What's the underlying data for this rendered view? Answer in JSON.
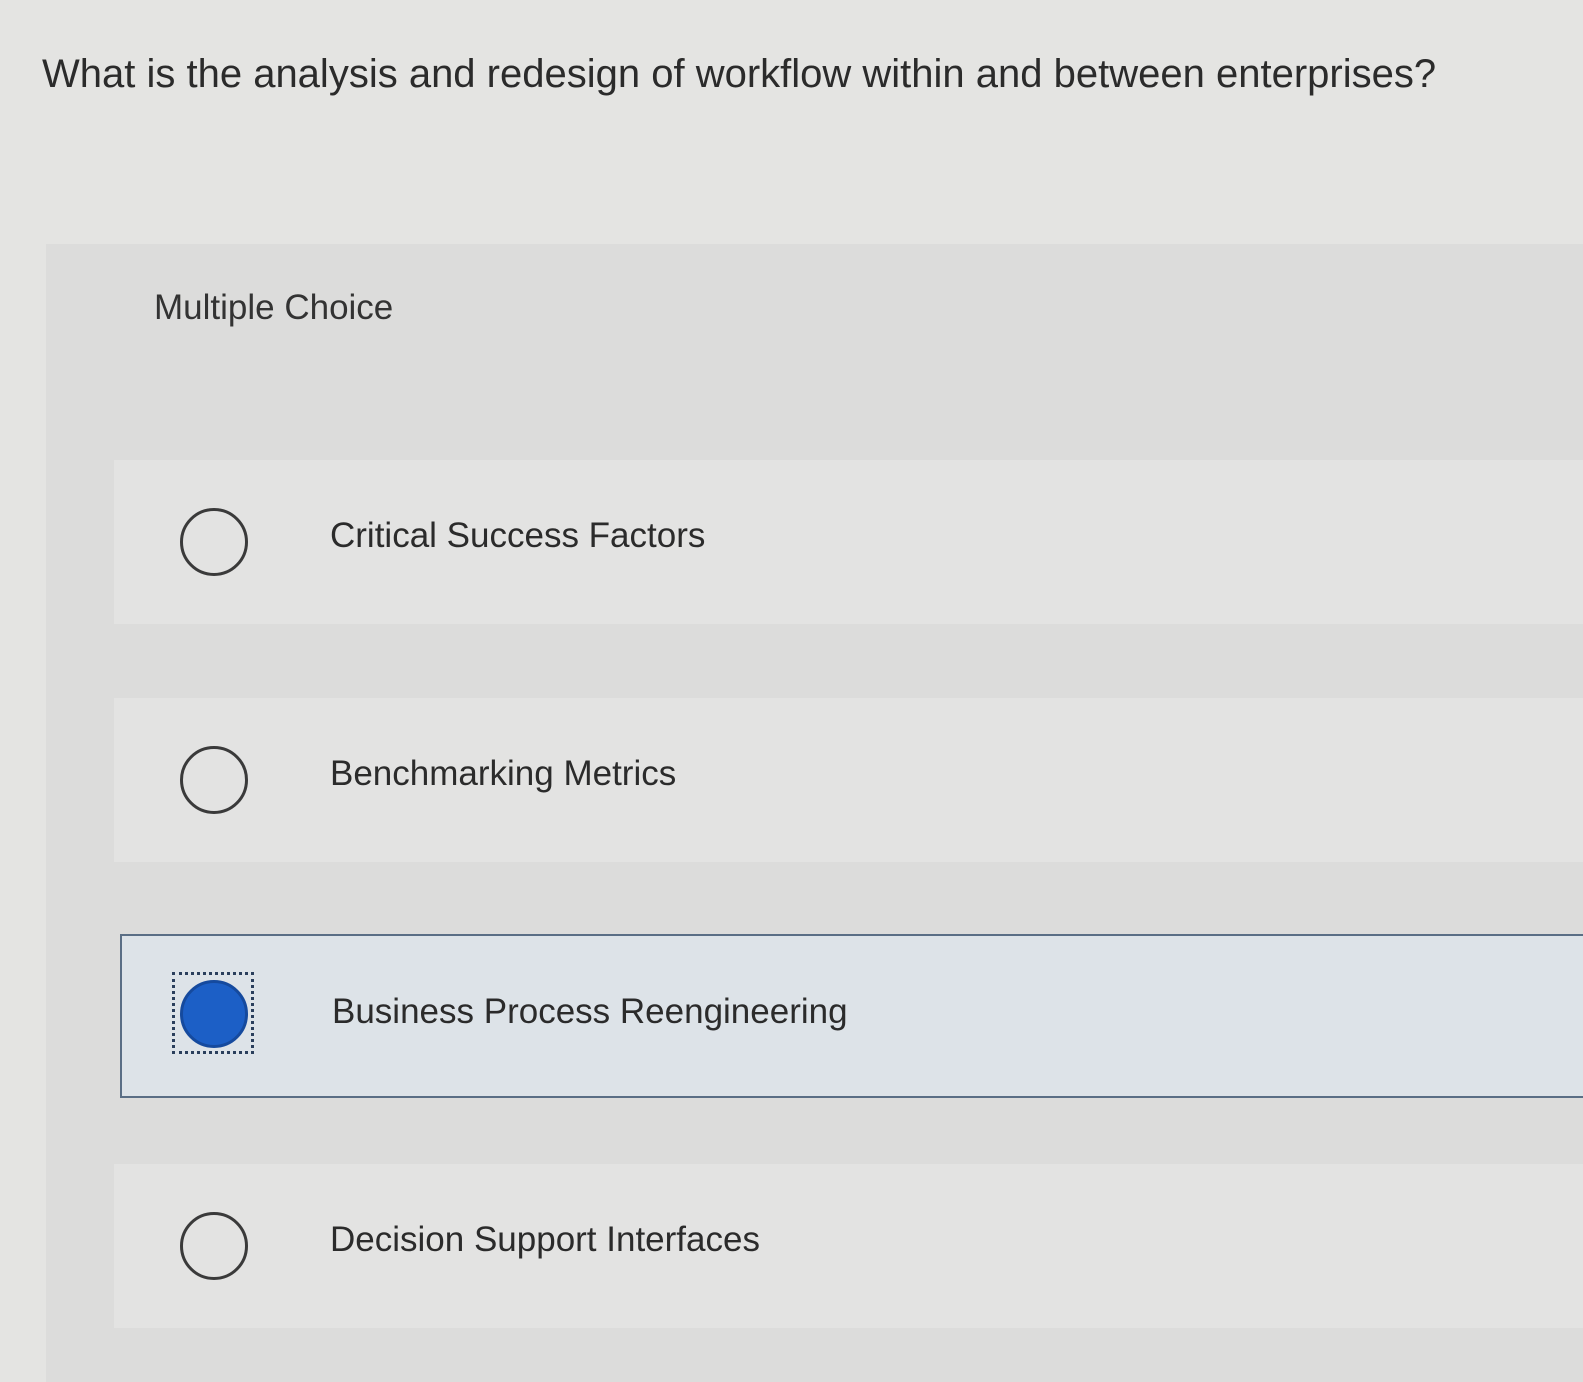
{
  "question": {
    "text": "What is the analysis and redesign of workflow within and between enterprises?"
  },
  "section_label": "Multiple Choice",
  "options": [
    {
      "label": "Critical Success Factors",
      "selected": false
    },
    {
      "label": "Benchmarking Metrics",
      "selected": false
    },
    {
      "label": "Business Process Reengineering",
      "selected": true
    },
    {
      "label": "Decision Support Interfaces",
      "selected": false
    }
  ],
  "colors": {
    "selected_fill": "#1c5fc6",
    "selected_border": "#5a6e85",
    "background": "#e4e4e2"
  }
}
